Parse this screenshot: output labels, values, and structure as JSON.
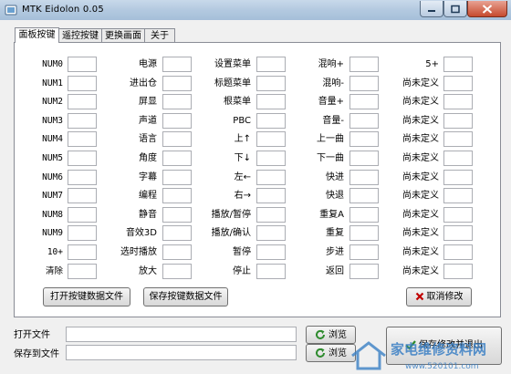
{
  "window": {
    "title": "MTK Eidolon 0.05"
  },
  "tabs": [
    {
      "label": "面板按键",
      "active": true
    },
    {
      "label": "遥控按键",
      "active": false
    },
    {
      "label": "更换画面",
      "active": false
    },
    {
      "label": "关于",
      "active": false
    }
  ],
  "grid": {
    "col1": [
      "NUM0",
      "NUM1",
      "NUM2",
      "NUM3",
      "NUM4",
      "NUM5",
      "NUM6",
      "NUM7",
      "NUM8",
      "NUM9",
      "10+",
      "清除"
    ],
    "col2": [
      "电源",
      "进出仓",
      "屏显",
      "声道",
      "语言",
      "角度",
      "字幕",
      "编程",
      "静音",
      "音效3D",
      "选时播放",
      "放大"
    ],
    "col3": [
      "设置菜单",
      "标题菜单",
      "根菜单",
      "PBC",
      "上↑",
      "下↓",
      "左←",
      "右→",
      "播放/暂停",
      "播放/确认",
      "暂停",
      "停止"
    ],
    "col4": [
      "混响+",
      "混响-",
      "音量+",
      "音量-",
      "上一曲",
      "下一曲",
      "快进",
      "快退",
      "重复A",
      "重复",
      "步进",
      "返回"
    ],
    "col5": [
      "5+",
      "尚未定义",
      "尚未定义",
      "尚未定义",
      "尚未定义",
      "尚未定义",
      "尚未定义",
      "尚未定义",
      "尚未定义",
      "尚未定义",
      "尚未定义",
      "尚未定义"
    ]
  },
  "panel_buttons": {
    "open_file": "打开按键数据文件",
    "save_file": "保存按键数据文件",
    "cancel": "取消修改"
  },
  "bottom": {
    "open_label": "打开文件",
    "save_label": "保存到文件",
    "browse": "浏览",
    "action": "保存修改并退出"
  },
  "watermark": {
    "text": "家电维修资料网",
    "url": "www.520101.com"
  },
  "colors": {
    "titlebar": "#b3c9e0",
    "close": "#c64a2e",
    "cancel_icon": "#c00000",
    "refresh_icon": "#2e8b2e",
    "watermark": "#3a7fc4"
  }
}
